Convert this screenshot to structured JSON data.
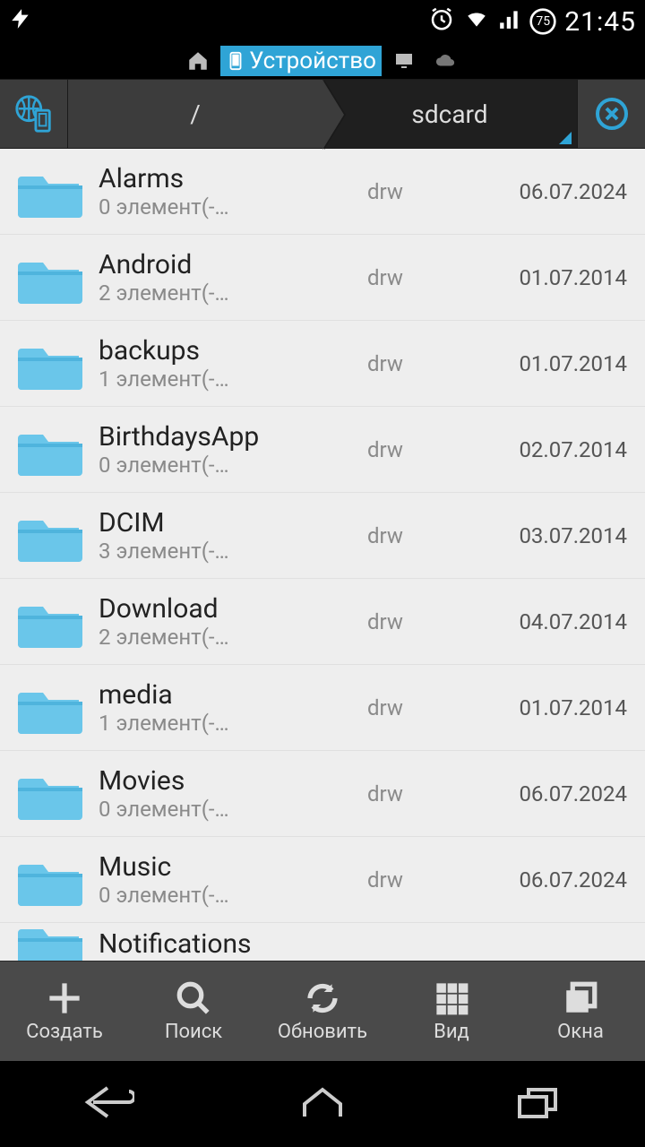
{
  "status": {
    "battery": "75",
    "time": "21:45"
  },
  "location_tabs": {
    "device_label": "Устройство"
  },
  "path": {
    "root": "/",
    "current": "sdcard"
  },
  "files": [
    {
      "name": "Alarms",
      "sub": "0 элемент(-…",
      "perm": "drw",
      "date": "06.07.2024"
    },
    {
      "name": "Android",
      "sub": "2 элемент(-…",
      "perm": "drw",
      "date": "01.07.2014"
    },
    {
      "name": "backups",
      "sub": "1 элемент(-…",
      "perm": "drw",
      "date": "01.07.2014"
    },
    {
      "name": "BirthdaysApp",
      "sub": "0 элемент(-…",
      "perm": "drw",
      "date": "02.07.2014"
    },
    {
      "name": "DCIM",
      "sub": "3 элемент(-…",
      "perm": "drw",
      "date": "03.07.2014"
    },
    {
      "name": "Download",
      "sub": "2 элемент(-…",
      "perm": "drw",
      "date": "04.07.2014"
    },
    {
      "name": "media",
      "sub": "1 элемент(-…",
      "perm": "drw",
      "date": "01.07.2014"
    },
    {
      "name": "Movies",
      "sub": "0 элемент(-…",
      "perm": "drw",
      "date": "06.07.2024"
    },
    {
      "name": "Music",
      "sub": "0 элемент(-…",
      "perm": "drw",
      "date": "06.07.2024"
    },
    {
      "name": "Notifications",
      "sub": "",
      "perm": "",
      "date": ""
    }
  ],
  "toolbar": {
    "create": "Создать",
    "search": "Поиск",
    "refresh": "Обновить",
    "view": "Вид",
    "windows": "Окна"
  }
}
